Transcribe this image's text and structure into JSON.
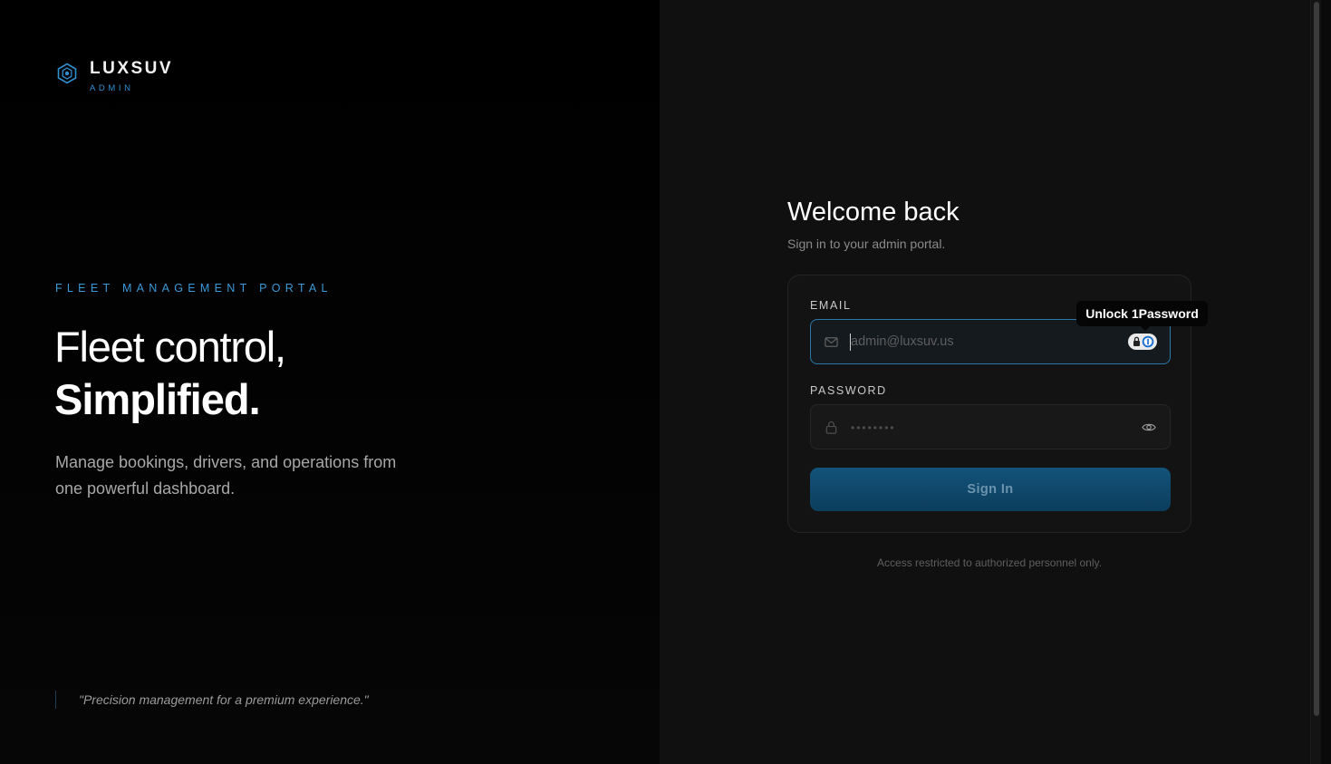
{
  "brand": {
    "name": "LUXSUV",
    "sub": "ADMIN",
    "icon": "hexagon-logo-icon",
    "accent_color": "#2f8fd0"
  },
  "hero": {
    "eyebrow": "FLEET MANAGEMENT PORTAL",
    "headline_line1": "Fleet control,",
    "headline_line2": "Simplified.",
    "description": "Manage bookings, drivers, and operations from one powerful dashboard.",
    "quote": "\"Precision management for a premium experience.\""
  },
  "login": {
    "title": "Welcome back",
    "subtitle": "Sign in to your admin portal.",
    "email": {
      "label": "EMAIL",
      "placeholder": "admin@luxsuv.us",
      "value": "",
      "icon": "mail-icon"
    },
    "password": {
      "label": "PASSWORD",
      "masked_value": "••••••••",
      "icon": "lock-icon",
      "toggle_icon": "eye-icon"
    },
    "submit_label": "Sign In",
    "footer_note": "Access restricted to authorized personnel only."
  },
  "password_manager": {
    "tooltip": "Unlock 1Password",
    "icon": "1password-icon"
  },
  "colors": {
    "button_top": "#13537a",
    "button_bottom": "#0c3d5c",
    "focus_border": "#2c77a8"
  }
}
